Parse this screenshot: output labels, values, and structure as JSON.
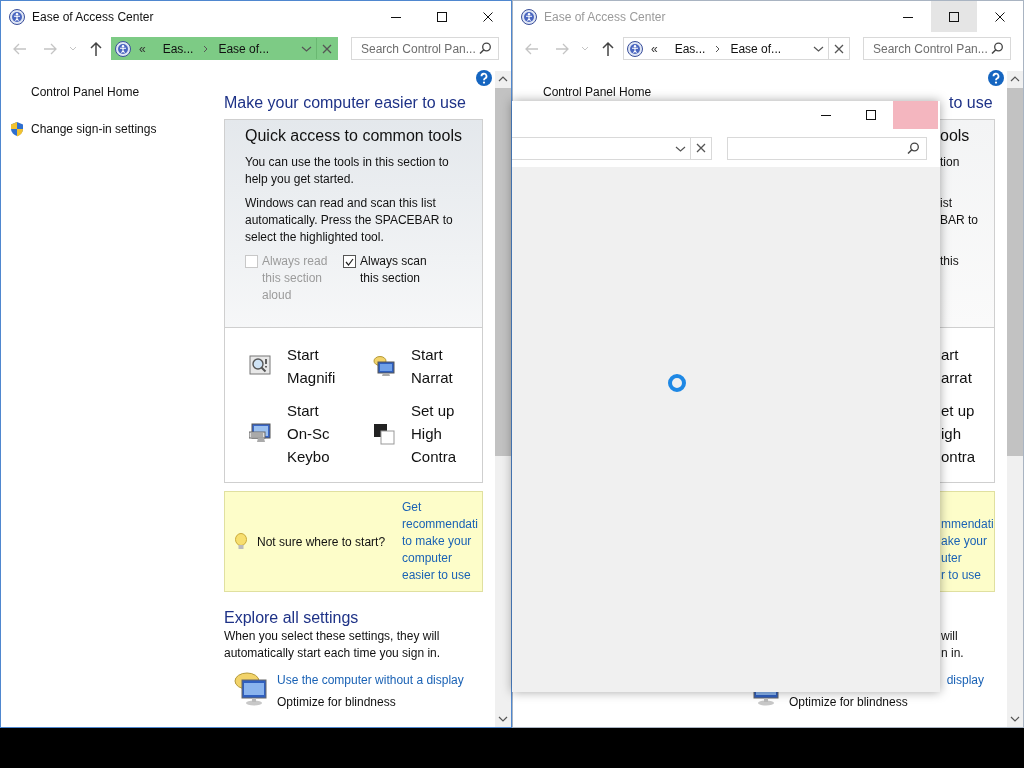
{
  "windows": [
    {
      "kind": "full",
      "title": "Ease of Access Center",
      "active": true,
      "title_buttons": [
        {
          "kind": "minimize",
          "hovered": false
        },
        {
          "kind": "maximize",
          "hovered": false
        },
        {
          "kind": "close",
          "hovered": false
        }
      ],
      "address": {
        "prefix": "«",
        "crumbs": [
          "Eas...",
          "Ease of..."
        ],
        "highlighted": true
      },
      "search": {
        "placeholder": "Search Control Pan..."
      },
      "sidebar": {
        "items": [
          {
            "label": "Control Panel Home",
            "kind": "plain"
          },
          {
            "label": "Change sign-in settings",
            "kind": "shield"
          }
        ]
      },
      "heading": "Make your computer easier to use",
      "quick_access": {
        "title": "Quick access to common tools",
        "paragraphs": [
          "You can use the tools in this section to help you get started.",
          "Windows can read and scan this list automatically.  Press the SPACEBAR to select the highlighted tool."
        ],
        "options": [
          {
            "label": "Always read this section aloud",
            "checked": false,
            "disabled": true
          },
          {
            "label": "Always scan this section",
            "checked": true,
            "disabled": false
          }
        ],
        "tools": [
          {
            "label": "Start Magnifi",
            "kind": "magnifier"
          },
          {
            "label": "Start Narrat",
            "kind": "narrator"
          },
          {
            "label": "Start On-Sc Keybo",
            "kind": "keyboard"
          },
          {
            "label": "Set up High Contra",
            "kind": "contrast"
          }
        ]
      },
      "tip": {
        "question": "Not sure where to start?",
        "link_lines": [
          "Get",
          "recommendati",
          "to make your",
          "computer",
          "easier to use"
        ]
      },
      "explore": {
        "title": "Explore all settings",
        "text": "When you select these settings, they will automatically start each time you sign in.",
        "items": [
          {
            "link": "Use the computer without a display",
            "description": "Optimize for blindness"
          }
        ]
      }
    },
    {
      "kind": "covered",
      "title": "Ease of Access Center",
      "active": false,
      "title_buttons": [
        {
          "kind": "minimize",
          "hovered": false
        },
        {
          "kind": "maximize",
          "hovered": true
        },
        {
          "kind": "close",
          "hovered": false
        }
      ],
      "address": {
        "prefix": "«",
        "crumbs": [
          "Eas...",
          "Ease of..."
        ],
        "highlighted": false
      },
      "search": {
        "placeholder": "Search Control Pan..."
      },
      "sidebar": {
        "items": [
          {
            "label": "Control Panel Home",
            "kind": "plain"
          }
        ]
      },
      "heading": "to use",
      "quick_access": {
        "title": "ools",
        "paragraph_1": [
          "tion"
        ],
        "paragraph_2": [
          "ist",
          "BAR to"
        ],
        "options": [
          "this"
        ],
        "tools": [
          [
            "art",
            "arrat"
          ],
          [
            "et up",
            "igh",
            "ontra"
          ]
        ]
      },
      "tip": {
        "link_lines": [
          "mmendati",
          "ake your",
          "uter",
          "r to use"
        ]
      },
      "explore": {
        "lines": [
          "will",
          "n in."
        ],
        "items": [
          {
            "link": "display",
            "description": "Optimize for blindness"
          }
        ]
      }
    }
  ],
  "dialog": {
    "title_buttons": [
      {
        "kind": "minimize",
        "hovered": false
      },
      {
        "kind": "maximize",
        "hovered": false
      },
      {
        "kind": "close",
        "hovered": true
      }
    ],
    "loading": true
  }
}
